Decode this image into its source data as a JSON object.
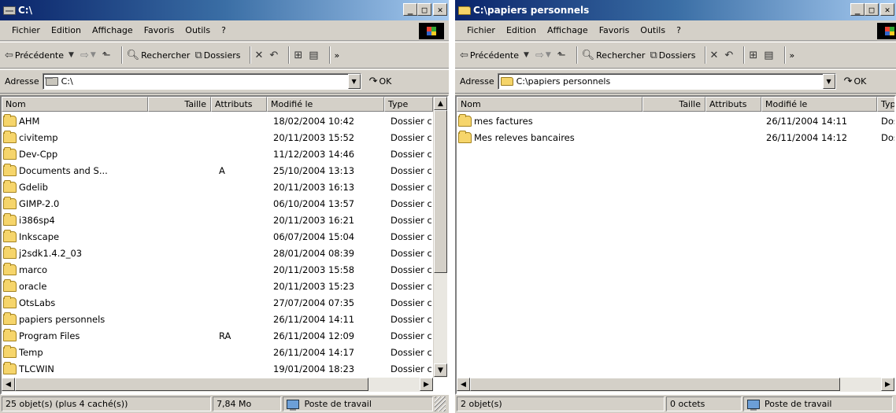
{
  "left": {
    "title": "C:\\",
    "menu": [
      "Fichier",
      "Edition",
      "Affichage",
      "Favoris",
      "Outils",
      "?"
    ],
    "toolbar": {
      "back": "Précédente",
      "search": "Rechercher",
      "folders": "Dossiers",
      "chevron": "»"
    },
    "address": {
      "label": "Adresse",
      "value": "C:\\",
      "ok": "OK"
    },
    "columns": {
      "name": "Nom",
      "size": "Taille",
      "attrs": "Attributs",
      "modified": "Modifié le",
      "type": "Type"
    },
    "rows": [
      {
        "name": "AHM",
        "attr": "",
        "mod": "18/02/2004 10:42",
        "type": "Dossier c"
      },
      {
        "name": "civitemp",
        "attr": "",
        "mod": "20/11/2003 15:52",
        "type": "Dossier c"
      },
      {
        "name": "Dev-Cpp",
        "attr": "",
        "mod": "11/12/2003 14:46",
        "type": "Dossier c"
      },
      {
        "name": "Documents and S...",
        "attr": "A",
        "mod": "25/10/2004 13:13",
        "type": "Dossier c"
      },
      {
        "name": "Gdelib",
        "attr": "",
        "mod": "20/11/2003 16:13",
        "type": "Dossier c"
      },
      {
        "name": "GIMP-2.0",
        "attr": "",
        "mod": "06/10/2004 13:57",
        "type": "Dossier c"
      },
      {
        "name": "i386sp4",
        "attr": "",
        "mod": "20/11/2003 16:21",
        "type": "Dossier c"
      },
      {
        "name": "Inkscape",
        "attr": "",
        "mod": "06/07/2004 15:04",
        "type": "Dossier c"
      },
      {
        "name": "j2sdk1.4.2_03",
        "attr": "",
        "mod": "28/01/2004 08:39",
        "type": "Dossier c"
      },
      {
        "name": "marco",
        "attr": "",
        "mod": "20/11/2003 15:58",
        "type": "Dossier c"
      },
      {
        "name": "oracle",
        "attr": "",
        "mod": "20/11/2003 15:23",
        "type": "Dossier c"
      },
      {
        "name": "OtsLabs",
        "attr": "",
        "mod": "27/07/2004 07:35",
        "type": "Dossier c"
      },
      {
        "name": "papiers personnels",
        "attr": "",
        "mod": "26/11/2004 14:11",
        "type": "Dossier c"
      },
      {
        "name": "Program Files",
        "attr": "RA",
        "mod": "26/11/2004 12:09",
        "type": "Dossier c"
      },
      {
        "name": "Temp",
        "attr": "",
        "mod": "26/11/2004 14:17",
        "type": "Dossier c"
      },
      {
        "name": "TLCWIN",
        "attr": "",
        "mod": "19/01/2004 18:23",
        "type": "Dossier c"
      }
    ],
    "status": {
      "count": "25 objet(s) (plus 4 caché(s))",
      "size": "7,84 Mo",
      "location": "Poste de travail"
    }
  },
  "right": {
    "title": "C:\\papiers personnels",
    "menu": [
      "Fichier",
      "Edition",
      "Affichage",
      "Favoris",
      "Outils",
      "?"
    ],
    "toolbar": {
      "back": "Précédente",
      "search": "Rechercher",
      "folders": "Dossiers",
      "chevron": "»"
    },
    "address": {
      "label": "Adresse",
      "value": "C:\\papiers personnels",
      "ok": "OK"
    },
    "columns": {
      "name": "Nom",
      "size": "Taille",
      "attrs": "Attributs",
      "modified": "Modifié le",
      "type": "Typ"
    },
    "rows": [
      {
        "name": "mes factures",
        "mod": "26/11/2004 14:11",
        "type": "Dos"
      },
      {
        "name": "Mes releves bancaires",
        "mod": "26/11/2004 14:12",
        "type": "Dos"
      }
    ],
    "status": {
      "count": "2 objet(s)",
      "size": "0 octets",
      "location": "Poste de travail"
    }
  }
}
